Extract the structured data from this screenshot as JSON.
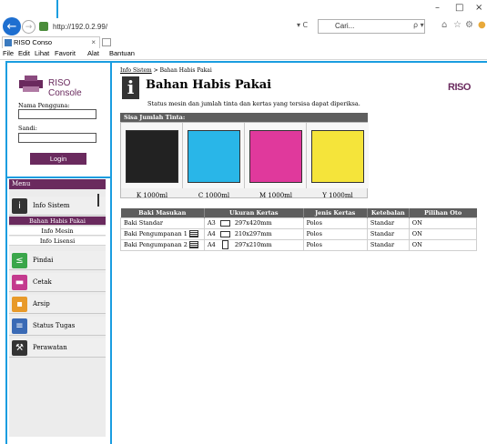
{
  "browser": {
    "address": "http://192.0.2.99/",
    "search_placeholder": "Cari...",
    "tab_title": "RISO Conso",
    "tab_close": "×",
    "refresh_glyph": "▾ C",
    "search_glyph": "ρ ▾",
    "window_controls": {
      "minimize": "–",
      "maximize": "□",
      "close": "×"
    },
    "menu": [
      {
        "label": "File"
      },
      {
        "label": "Edit"
      },
      {
        "label": "Lihat"
      },
      {
        "label": "Favorit"
      },
      {
        "label": "Alat"
      },
      {
        "label": "Bantuan"
      }
    ]
  },
  "login": {
    "logo_text": "RISO Console",
    "username_label": "Nama Pengguna:",
    "password_label": "Sandi:",
    "button_label": "Login"
  },
  "sidebar": {
    "header": "Menu",
    "items": [
      {
        "label": "Info Sistem",
        "icon": "info-icon",
        "color": "#333333"
      },
      {
        "label": "Pindai",
        "icon": "scan-icon",
        "color": "#3aa64a"
      },
      {
        "label": "Cetak",
        "icon": "print-icon",
        "color": "#c43a8e"
      },
      {
        "label": "Arsip",
        "icon": "archive-icon",
        "color": "#e89a2a"
      },
      {
        "label": "Status Tugas",
        "icon": "job-status-icon",
        "color": "#3a6ab5"
      },
      {
        "label": "Perawatan",
        "icon": "maintenance-icon",
        "color": "#333333"
      }
    ],
    "sub_items": [
      {
        "label": "Bahan Habis Pakai",
        "active": true
      },
      {
        "label": "Info Mesin"
      },
      {
        "label": "Info Lisensi"
      }
    ]
  },
  "main": {
    "breadcrumb_link": "Info Sistem",
    "breadcrumb_rest": " > Bahan Habis Pakai",
    "title": "Bahan Habis Pakai",
    "description": "Status mesin dan jumlah tinta dan kertas yang tersisa dapat diperiksa.",
    "brand_logo": "RISO",
    "ink_header": "Sisa Jumlah Tinta:",
    "inks": [
      {
        "label": "K 1000ml",
        "color": "#222222"
      },
      {
        "label": "C 1000ml",
        "color": "#29b6e8"
      },
      {
        "label": "M 1000ml",
        "color": "#e0399c"
      },
      {
        "label": "Y 1000ml",
        "color": "#f5e43a"
      }
    ],
    "paper_table": {
      "headers": [
        "Baki Masukan",
        "Ukuran Kertas",
        "Jenis Kertas",
        "Ketebalan",
        "Pilihan Oto"
      ],
      "rows": [
        {
          "tray": "Baki Standar",
          "has_icon": false,
          "size": "A3",
          "orient": "landscape",
          "dims": "297x420mm",
          "type": "Polos",
          "thickness": "Standar",
          "auto": "ON"
        },
        {
          "tray": "Baki Pengumpanan 1",
          "has_icon": true,
          "size": "A4",
          "orient": "landscape",
          "dims": "210x297mm",
          "type": "Polos",
          "thickness": "Standar",
          "auto": "ON"
        },
        {
          "tray": "Baki Pengumpanan 2",
          "has_icon": true,
          "size": "A4",
          "orient": "portrait",
          "dims": "297x210mm",
          "type": "Polos",
          "thickness": "Standar",
          "auto": "ON"
        }
      ]
    }
  }
}
